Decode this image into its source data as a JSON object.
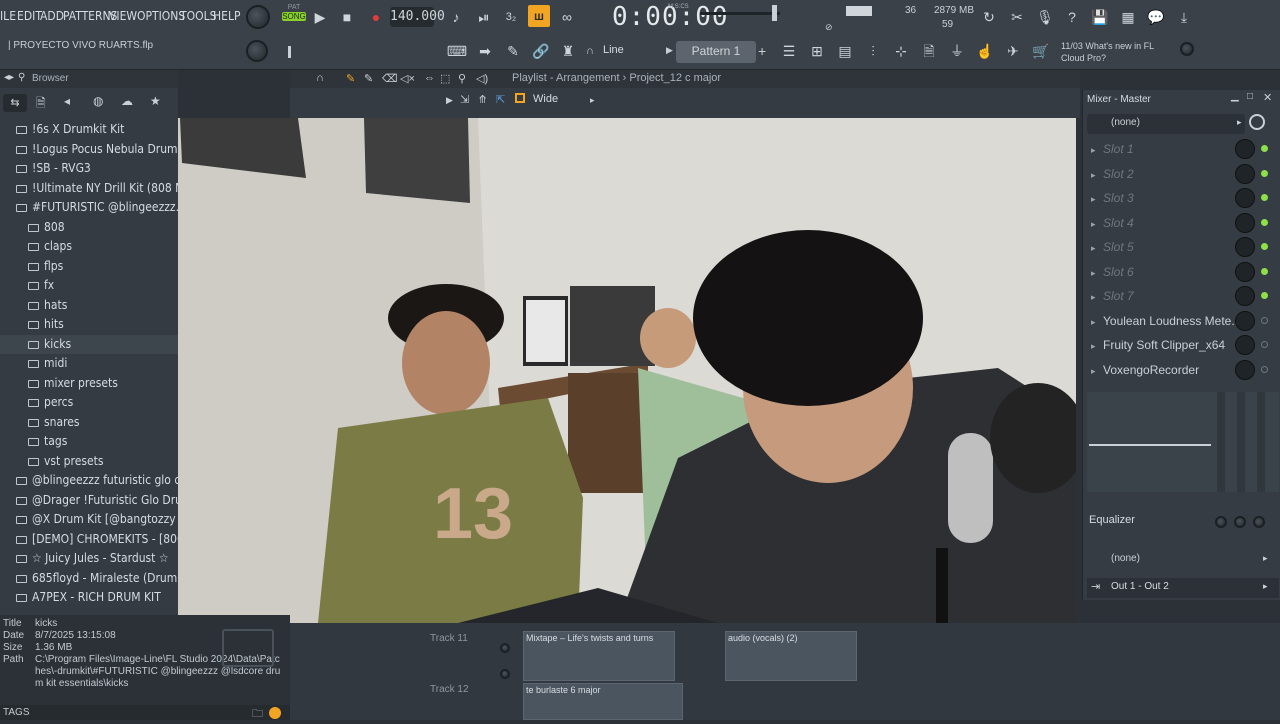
{
  "menu": [
    "ILE",
    "EDIT",
    "ADD",
    "PATTERNS",
    "VIEW",
    "OPTIONS",
    "TOOLS",
    "HELP"
  ],
  "transport": {
    "pat_label": "PAT",
    "song_label": "SONG",
    "tempo": "140.000",
    "time": "0:00:00",
    "time_unit": "M:S:CS"
  },
  "project": {
    "name": "| PROYECTO VIVO RUARTS.flp"
  },
  "cpu": {
    "value": "36",
    "memory": "2879 MB",
    "voices": "59"
  },
  "snap": {
    "mode": "Line",
    "pattern": "Pattern 1"
  },
  "news": {
    "count": "11/03",
    "text": "What's new in FL Cloud Pro?"
  },
  "browser": {
    "title": "Browser",
    "items": [
      {
        "label": "!6s X Drumkit Kit",
        "indent": 0
      },
      {
        "label": "!Logus Pocus Nebula Drum Kit",
        "indent": 0
      },
      {
        "label": "!SB - RVG3",
        "indent": 0
      },
      {
        "label": "!Ultimate NY Drill Kit (808 Me",
        "indent": 0
      },
      {
        "label": "#FUTURISTIC @blingeezzz..sdcore",
        "indent": 0,
        "open": true
      },
      {
        "label": "808",
        "indent": 1
      },
      {
        "label": "claps",
        "indent": 1
      },
      {
        "label": "flps",
        "indent": 1
      },
      {
        "label": "fx",
        "indent": 1
      },
      {
        "label": "hats",
        "indent": 1
      },
      {
        "label": "hits",
        "indent": 1
      },
      {
        "label": "kicks",
        "indent": 1,
        "selected": true
      },
      {
        "label": "midi",
        "indent": 1
      },
      {
        "label": "mixer presets",
        "indent": 1
      },
      {
        "label": "percs",
        "indent": 1
      },
      {
        "label": "snares",
        "indent": 1
      },
      {
        "label": "tags",
        "indent": 1
      },
      {
        "label": "vst presets",
        "indent": 1
      },
      {
        "label": "@blingeezzz futuristic glo dr",
        "indent": 0
      },
      {
        "label": "@Drager !Futuristic Glo Drum",
        "indent": 0
      },
      {
        "label": "@X Drum Kit [@bangtozzy &",
        "indent": 0
      },
      {
        "label": "[DEMO] CHROMEKITS - [800.Y",
        "indent": 0
      },
      {
        "label": "☆ Juicy Jules - Stardust ☆",
        "indent": 0
      },
      {
        "label": "685floyd - Miraleste (Drum",
        "indent": 0
      },
      {
        "label": "A7PEX - RICH DRUM KIT",
        "indent": 0
      }
    ]
  },
  "info": {
    "title_label": "Title",
    "title": "kicks",
    "date_label": "Date",
    "date": "8/7/2025 13:15:08",
    "size_label": "Size",
    "size": "1.36 MB",
    "path_label": "Path",
    "path": "C:\\Program Files\\Image-Line\\FL Studio 2024\\Data\\Patches\\-drumkit\\#FUTURISTIC @blingeezzz @lsdcore drum kit essentials\\kicks",
    "tags_label": "TAGS"
  },
  "playlist": {
    "breadcrumb": "Playlist - Arrangement › Project_12 c major",
    "zoom": "Wide"
  },
  "tracks": [
    {
      "label": "Track 11",
      "clips": [
        "Mixtape – Life's twists and turns",
        "audio (vocals) (2)"
      ]
    },
    {
      "label": "Track 12",
      "clips": [
        "te burlaste 6 major"
      ]
    }
  ],
  "mixer": {
    "title": "Mixer - Master",
    "input": "(none)",
    "slots": [
      "Slot 1",
      "Slot 2",
      "Slot 3",
      "Slot 4",
      "Slot 5",
      "Slot 6",
      "Slot 7"
    ],
    "effects": [
      "Youlean Loudness Mete...",
      "Fruity Soft Clipper_x64",
      "VoxengoRecorder"
    ],
    "eq_label": "Equalizer",
    "out_none": "(none)",
    "output": "Out 1 - Out 2"
  },
  "colors": {
    "accent": "#f2a522",
    "song_green": "#8ad12b",
    "led_green": "#8ee04a",
    "record_red": "#e23b3b"
  }
}
